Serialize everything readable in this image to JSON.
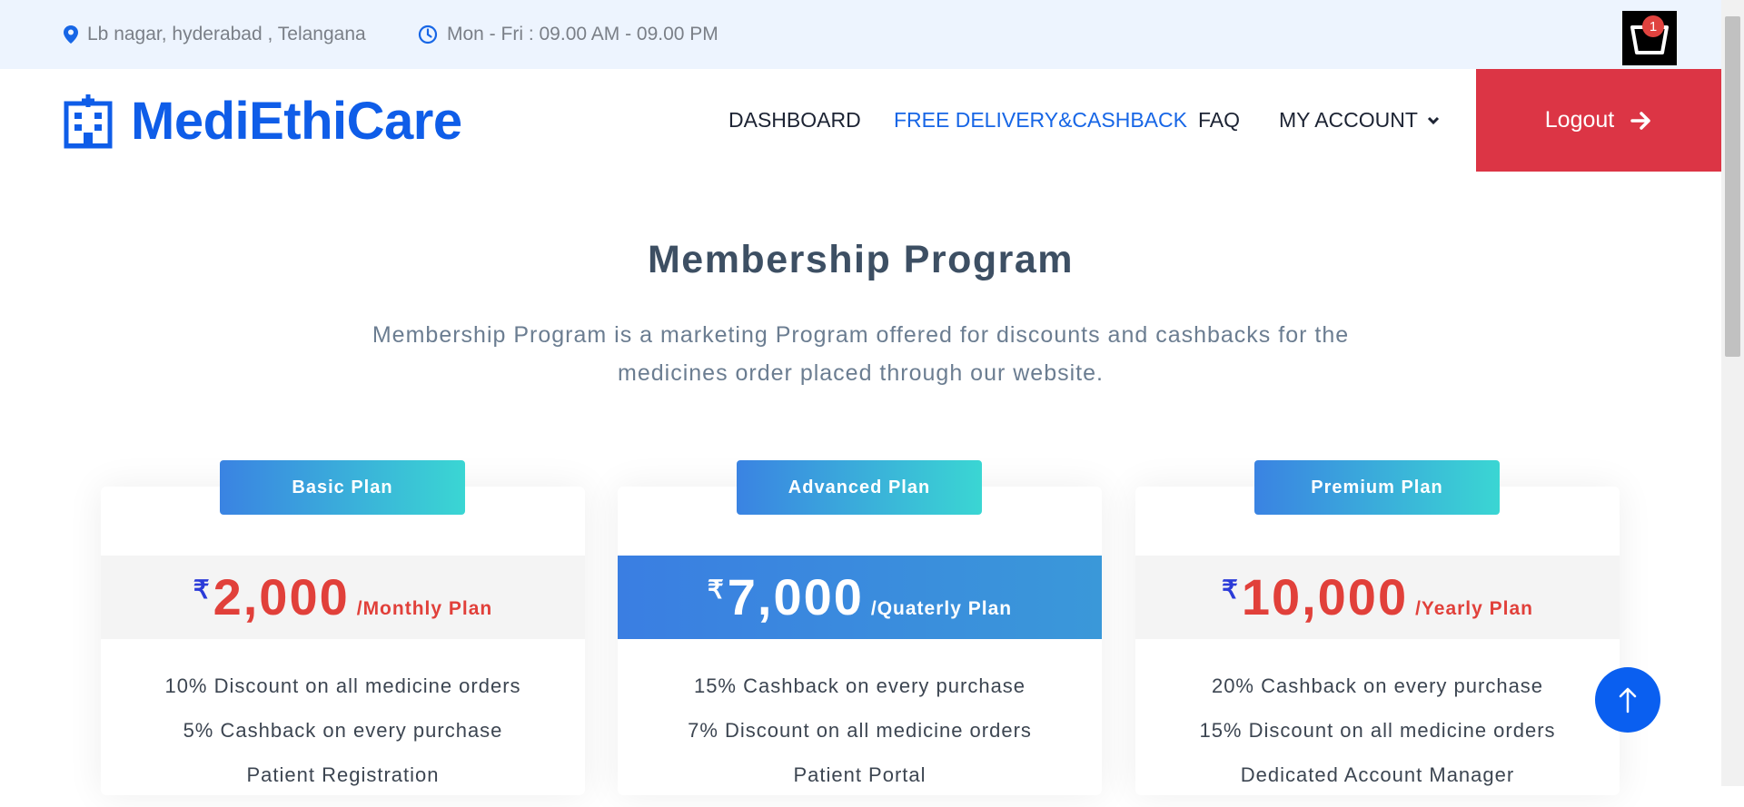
{
  "topbar": {
    "location": "Lb nagar, hyderabad , Telangana",
    "hours": "Mon - Fri : 09.00 AM - 09.00 PM",
    "cart_count": "1"
  },
  "header": {
    "brand": "MediEthiCare",
    "nav": {
      "dashboard": "DASHBOARD",
      "free_delivery": "FREE DELIVERY&CASHBACK",
      "faq": "FAQ",
      "my_account": "MY ACCOUNT"
    },
    "logout": "Logout"
  },
  "section": {
    "title": "Membership Program",
    "subtitle": "Membership Program is a marketing Program offered for discounts and cashbacks for the medicines order placed through our website."
  },
  "plans": [
    {
      "name": "Basic Plan",
      "currency": "₹",
      "price": "2,000",
      "period": "/Monthly Plan",
      "features": [
        "10% Discount on all medicine orders",
        "5% Cashback on every purchase",
        "Patient Registration"
      ]
    },
    {
      "name": "Advanced Plan",
      "currency": "₹",
      "price": "7,000",
      "period": "/Quaterly Plan",
      "features": [
        "15% Cashback on every purchase",
        "7% Discount on all medicine orders",
        "Patient Portal"
      ]
    },
    {
      "name": "Premium Plan",
      "currency": "₹",
      "price": "10,000",
      "period": "/Yearly Plan",
      "features": [
        "20% Cashback on every purchase",
        "15% Discount on all medicine orders",
        "Dedicated Account Manager"
      ]
    }
  ],
  "colors": {
    "brand_blue": "#0f5de8",
    "logout_red": "#dc3545",
    "price_red": "#e1403a",
    "topbar_bg": "#edf4fe"
  }
}
